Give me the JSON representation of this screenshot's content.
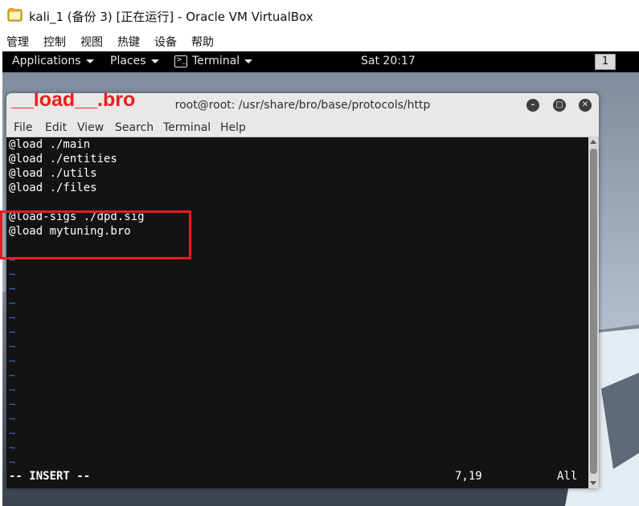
{
  "host_window": {
    "title": "kali_1 (备份 3) [正在运行] - Oracle VM VirtualBox",
    "icon": "virtualbox-icon",
    "menu": [
      "管理",
      "控制",
      "视图",
      "热键",
      "设备",
      "帮助"
    ]
  },
  "panel": {
    "applications": "Applications",
    "places": "Places",
    "terminal": "Terminal",
    "clock": "Sat 20:17",
    "workspace": "1"
  },
  "terminal_window": {
    "overlay_label": "__load__.bro",
    "title": "root@root: /usr/share/bro/base/protocols/http",
    "menu": [
      "File",
      "Edit",
      "View",
      "Search",
      "Terminal",
      "Help"
    ],
    "lines": [
      "@load ./main",
      "@load ./entities",
      "@load ./utils",
      "@load ./files",
      "",
      "@load-sigs ./dpd.sig",
      "@load mytuning.bro"
    ],
    "tilde": "~",
    "status": {
      "mode": "-- INSERT --",
      "position": "7,19",
      "scroll": "All"
    }
  },
  "colors": {
    "highlight_border": "#e51c23",
    "overlay_text": "#e8201e",
    "vim_tilde": "#3b6fe0"
  }
}
